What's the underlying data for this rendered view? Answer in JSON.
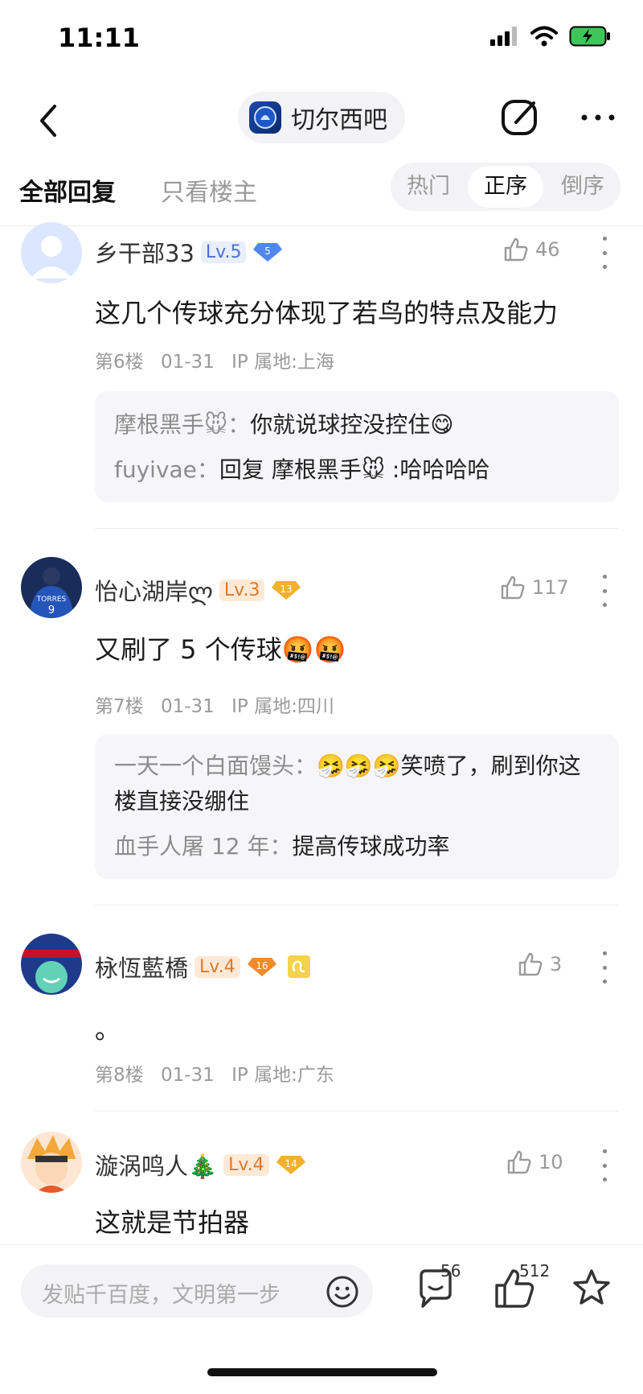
{
  "status": {
    "time": "11:11"
  },
  "nav": {
    "forum_name": "切尔西吧"
  },
  "tabs": {
    "all": "全部回复",
    "op_only": "只看楼主",
    "sort": [
      "热门",
      "正序",
      "倒序"
    ],
    "active_sort": "正序"
  },
  "posts": [
    {
      "username": "乡干部33",
      "level": "Lv.5",
      "badge": "5",
      "likes": "46",
      "content": "这几个传球充分体现了若鸟的特点及能力",
      "floor": "第6楼",
      "date": "01-31",
      "ip": "IP 属地:上海",
      "replies": [
        {
          "author": "摩根黑手🐭：",
          "text": "你就说球控没控住😋"
        },
        {
          "author": "fuyivae：",
          "text": "回复 摩根黑手🐭 :哈哈哈哈"
        }
      ]
    },
    {
      "username": "怡心湖岸ლ",
      "level": "Lv.3",
      "badge": "13",
      "likes": "117",
      "content": "又刷了 5 个传球🤬🤬",
      "floor": "第7楼",
      "date": "01-31",
      "ip": "IP 属地:四川",
      "replies": [
        {
          "author": "一天一个白面馒头：",
          "text": "🤧🤧🤧笑喷了，刷到你这楼直接没绷住"
        },
        {
          "author": "血手人屠 12 年：",
          "text": "提高传球成功率"
        }
      ]
    },
    {
      "username": "栐恆藍橋",
      "level": "Lv.4",
      "badge": "16",
      "likes": "3",
      "content": "。",
      "floor": "第8楼",
      "date": "01-31",
      "ip": "IP 属地:广东"
    },
    {
      "username": "漩涡鸣人🎄",
      "level": "Lv.4",
      "badge": "14",
      "likes": "10",
      "content": "这就是节拍器"
    }
  ],
  "bottom": {
    "placeholder": "发贴千百度，文明第一步",
    "comments": "56",
    "likes": "512"
  },
  "colors": {
    "accent": "#4d6fd6",
    "level_orange": "#d97a2b",
    "gray": "#9a9a9a"
  }
}
